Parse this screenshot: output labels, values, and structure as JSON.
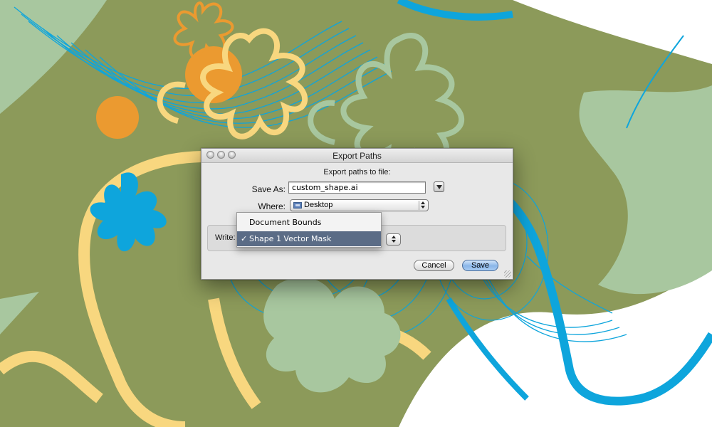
{
  "dialog": {
    "title": "Export Paths",
    "subtitle": "Export paths to file:",
    "save_as_label": "Save As:",
    "save_as_value": "custom_shape.ai",
    "where_label": "Where:",
    "where_value": "Desktop",
    "write_label": "Write:",
    "cancel_label": "Cancel",
    "save_label": "Save"
  },
  "write_menu": {
    "items": [
      {
        "label": "Document Bounds",
        "checked": false
      },
      {
        "label": "Shape 1 Vector Mask",
        "checked": true,
        "check_mark": "✓"
      }
    ]
  },
  "colors": {
    "olive": "#8c9a5a",
    "sage": "#a8c79f",
    "blue": "#0ea5dc",
    "yellow": "#f8d77f",
    "orange": "#eb9a30",
    "menu_highlight": "#5b6c86"
  }
}
